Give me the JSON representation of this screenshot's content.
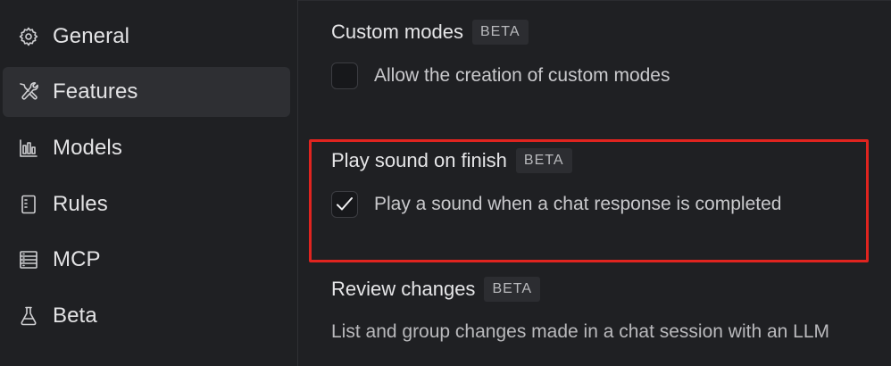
{
  "sidebar": {
    "items": [
      {
        "label": "General",
        "icon": "gear-icon",
        "active": false
      },
      {
        "label": "Features",
        "icon": "tools-icon",
        "active": true
      },
      {
        "label": "Models",
        "icon": "bar-chart-icon",
        "active": false
      },
      {
        "label": "Rules",
        "icon": "document-icon",
        "active": false
      },
      {
        "label": "MCP",
        "icon": "server-icon",
        "active": false
      },
      {
        "label": "Beta",
        "icon": "flask-icon",
        "active": false
      }
    ]
  },
  "main": {
    "custom_modes": {
      "title": "Custom modes",
      "badge": "BETA",
      "option_label": "Allow the creation of custom modes",
      "checked": false
    },
    "play_sound": {
      "title": "Play sound on finish",
      "badge": "BETA",
      "option_label": "Play a sound when a chat response is completed",
      "checked": true
    },
    "review_changes": {
      "title": "Review changes",
      "badge": "BETA",
      "description": "List and group changes made in a chat session with an LLM"
    }
  },
  "colors": {
    "background": "#1f2023",
    "active_item": "#2e2f33",
    "highlight": "#e0241f",
    "badge_bg": "#2c2d31"
  }
}
